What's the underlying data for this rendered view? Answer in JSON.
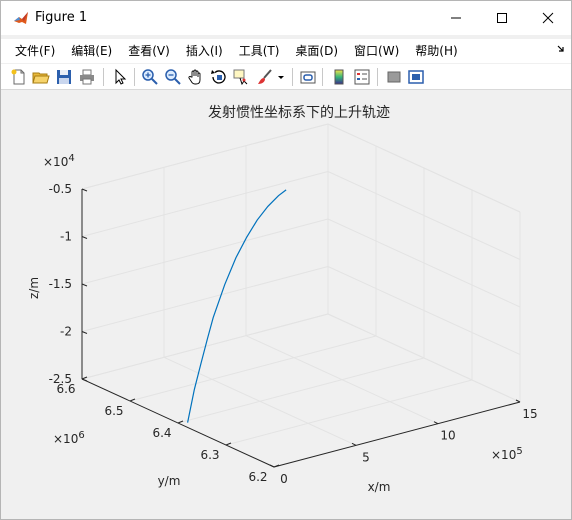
{
  "window": {
    "title": "Figure 1"
  },
  "menubar": {
    "items": [
      "文件(F)",
      "编辑(E)",
      "查看(V)",
      "插入(I)",
      "工具(T)",
      "桌面(D)",
      "窗口(W)",
      "帮助(H)"
    ]
  },
  "toolbar": {
    "icons": [
      "new-figure-icon",
      "open-file-icon",
      "save-icon",
      "print-icon",
      "pointer-icon",
      "zoom-in-icon",
      "zoom-out-icon",
      "pan-icon",
      "rotate-3d-icon",
      "data-cursor-icon",
      "brush-icon",
      "dropdown-arrow-icon",
      "link-plot-icon",
      "colorbar-icon",
      "legend-icon",
      "hide-plot-tools-icon",
      "show-plot-tools-icon"
    ]
  },
  "chart_data": {
    "type": "line",
    "view": "3d",
    "title": "发射惯性坐标系下的上升轨迹",
    "xlabel": "x/m",
    "ylabel": "y/m",
    "zlabel": "z/m",
    "x_exponent": "10^5",
    "y_exponent": "10^6",
    "z_exponent": "10^4",
    "x_ticks": [
      "0",
      "5",
      "10",
      "15"
    ],
    "y_ticks": [
      "6.2",
      "6.3",
      "6.4",
      "6.5",
      "6.6"
    ],
    "z_ticks": [
      "-2.5",
      "-2",
      "-1.5",
      "-1",
      "-0.5"
    ],
    "xlim": [
      0,
      15
    ],
    "ylim": [
      6.2,
      6.6
    ],
    "zlim": [
      -2.5,
      -0.5
    ],
    "grid": true,
    "line_color": "#0072bd",
    "series": [
      {
        "x": [
          0.0,
          0.5,
          1.0,
          1.5,
          2.0,
          3.0,
          4.0,
          5.0,
          6.0,
          7.0,
          8.0,
          8.7
        ],
        "y": [
          6.38,
          6.383,
          6.386,
          6.39,
          6.395,
          6.405,
          6.416,
          6.428,
          6.44,
          6.452,
          6.464,
          6.472
        ],
        "z": [
          -2.45,
          -2.13,
          -1.88,
          -1.66,
          -1.47,
          -1.19,
          -0.98,
          -0.84,
          -0.73,
          -0.66,
          -0.62,
          -0.61
        ]
      }
    ]
  }
}
